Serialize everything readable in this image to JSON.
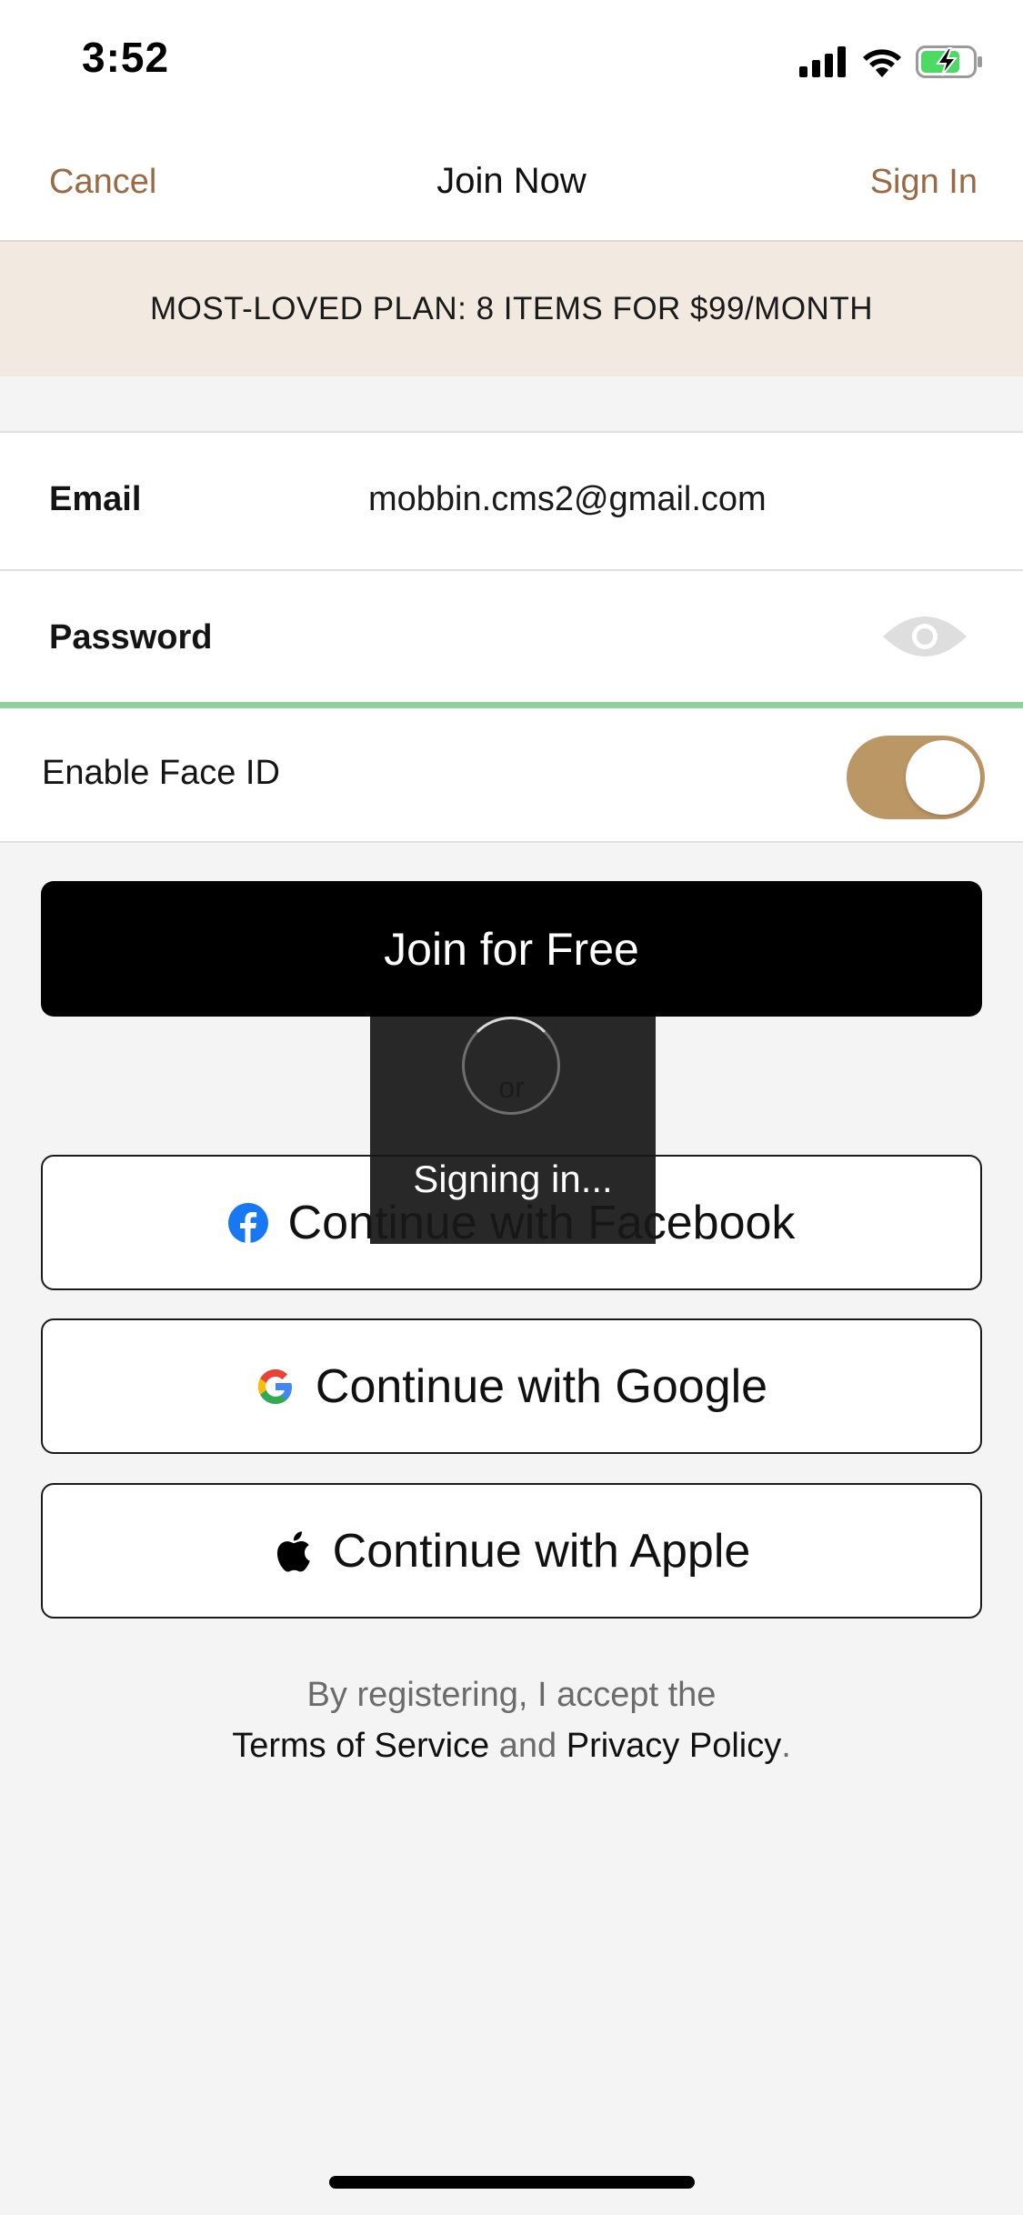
{
  "status_bar": {
    "time": "3:52",
    "icons": [
      "cellular-signal-icon",
      "wifi-icon",
      "battery-charging-icon"
    ]
  },
  "nav": {
    "cancel_label": "Cancel",
    "title": "Join Now",
    "sign_in_label": "Sign In"
  },
  "promo": {
    "text": "MOST-LOVED PLAN: 8 ITEMS FOR $99/MONTH"
  },
  "form": {
    "email_label": "Email",
    "email_value": "mobbin.cms2@gmail.com",
    "password_label": "Password",
    "password_value": "",
    "face_id_label": "Enable Face ID",
    "face_id_enabled": true
  },
  "actions": {
    "join_label": "Join for Free",
    "or_label": "or",
    "facebook_label": "Continue with Facebook",
    "google_label": "Continue with Google",
    "apple_label": "Continue with Apple"
  },
  "terms": {
    "prefix": "By registering, I accept the",
    "tos_label": "Terms of Service",
    "and_label": "and",
    "privacy_label": "Privacy Policy",
    "suffix": "."
  },
  "overlay": {
    "loading_text": "Signing in..."
  },
  "colors": {
    "accent": "#9a6a44",
    "promo_bg": "#f2e9e1",
    "toggle_on": "#bc9766",
    "password_strength": "#8fd19e",
    "facebook_blue": "#1877f2"
  }
}
